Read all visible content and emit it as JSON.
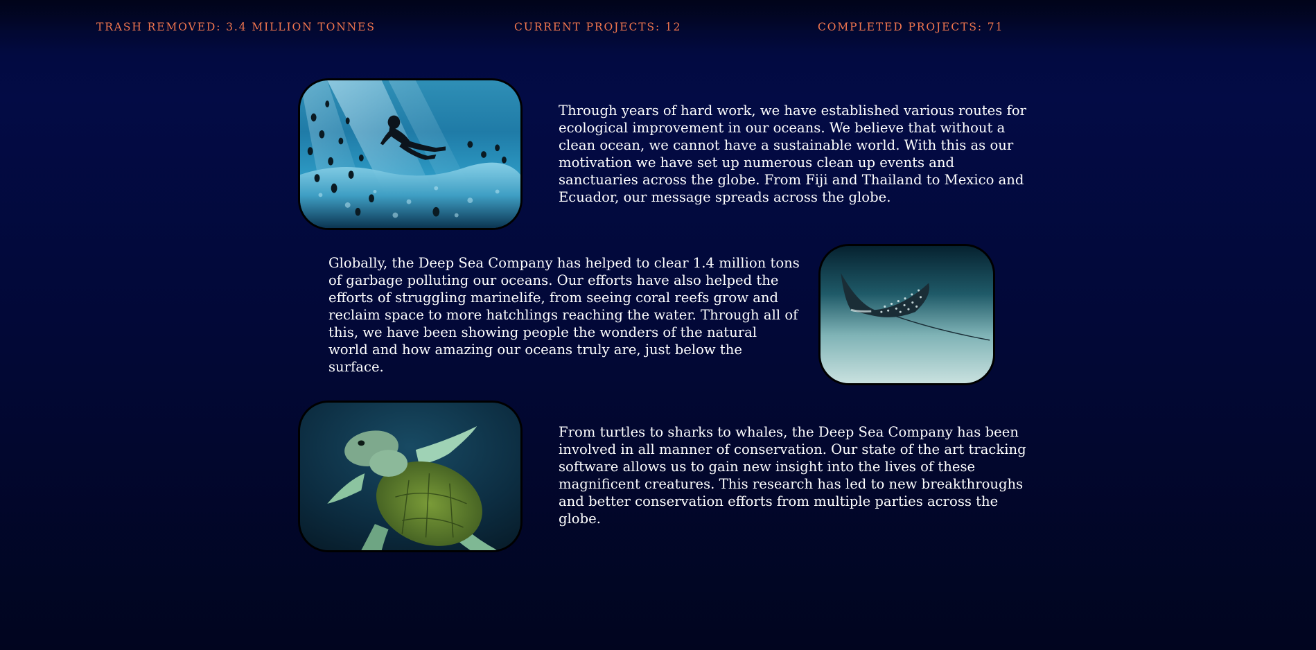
{
  "stats": {
    "trash_removed": "TRASH REMOVED: 3.4 MILLION TONNES",
    "current_projects": "CURRENT PROJECTS: 12",
    "completed_projects": "COMPLETED PROJECTS: 71"
  },
  "colors": {
    "stat_text": "#f4774f",
    "body_text": "#ffffff",
    "background": "#020836"
  },
  "sections": [
    {
      "image": "snorkeler-with-fish-photo",
      "text": "Through years of hard work, we have established various routes for ecological improvement in our oceans. We believe that without a clean ocean, we cannot have a sustainable world. With this as our motivation we have set up numerous clean up events and sanctuaries across the globe. From Fiji and Thailand to Mexico and Ecuador, our message spreads across the globe."
    },
    {
      "image": "spotted-eagle-ray-photo",
      "text": "Globally, the Deep Sea Company has helped to clear 1.4 million tons of garbage polluting our oceans. Our efforts have also helped the efforts of struggling marinelife, from seeing coral reefs grow and reclaim space to more hatchlings reaching the water. Through all of this, we have been showing people the wonders of the natural world and how amazing our oceans truly are, just below the surface."
    },
    {
      "image": "sea-turtle-photo",
      "text": "From turtles to sharks to whales, the Deep Sea Company has been involved in all manner of conservation. Our state of the art tracking software allows us to gain new insight into the lives of these magnificent creatures. This research has led to new breakthroughs and better conservation efforts from multiple parties across the globe."
    }
  ]
}
